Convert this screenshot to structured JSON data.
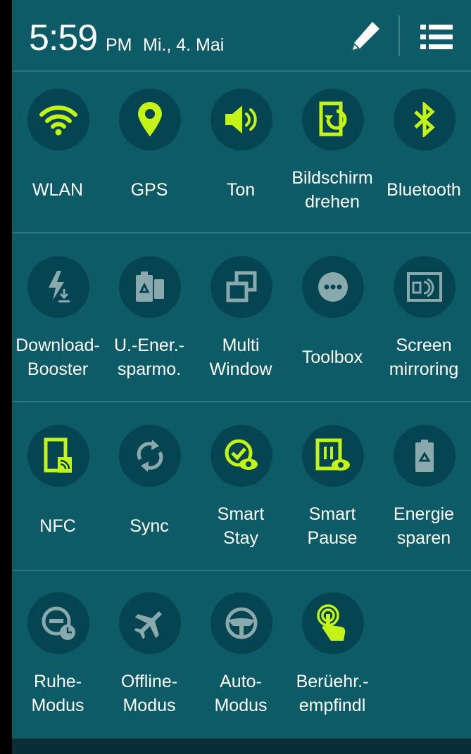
{
  "status": {
    "time": "5:59",
    "ampm": "PM",
    "date": "Mi., 4. Mai"
  },
  "colors": {
    "active": "#c4f318",
    "inactive": "#8aa9ad",
    "panel": "#0d5b66",
    "circle": "#054552"
  },
  "rows": [
    [
      {
        "label": "WLAN",
        "icon": "wifi-icon",
        "active": true
      },
      {
        "label": "GPS",
        "icon": "location-pin-icon",
        "active": true
      },
      {
        "label": "Ton",
        "icon": "speaker-icon",
        "active": true
      },
      {
        "label": "Bildschirm\ndrehen",
        "icon": "screen-rotation-icon",
        "active": true
      },
      {
        "label": "Bluetooth",
        "icon": "bluetooth-icon",
        "active": true
      }
    ],
    [
      {
        "label": "Download-\nBooster",
        "icon": "download-booster-icon",
        "active": false
      },
      {
        "label": "U.-Ener.-\nsparmo.",
        "icon": "ultra-power-saving-icon",
        "active": false
      },
      {
        "label": "Multi\nWindow",
        "icon": "multi-window-icon",
        "active": false
      },
      {
        "label": "Toolbox",
        "icon": "toolbox-icon",
        "active": false
      },
      {
        "label": "Screen\nmirroring",
        "icon": "screen-mirroring-icon",
        "active": false
      }
    ],
    [
      {
        "label": "NFC",
        "icon": "nfc-icon",
        "active": true
      },
      {
        "label": "Sync",
        "icon": "sync-icon",
        "active": false
      },
      {
        "label": "Smart\nStay",
        "icon": "smart-stay-icon",
        "active": true
      },
      {
        "label": "Smart\nPause",
        "icon": "smart-pause-icon",
        "active": true
      },
      {
        "label": "Energie\nsparen",
        "icon": "power-saving-icon",
        "active": false
      }
    ],
    [
      {
        "label": "Ruhe-\nModus",
        "icon": "blocking-mode-icon",
        "active": false
      },
      {
        "label": "Offline-\nModus",
        "icon": "airplane-icon",
        "active": false
      },
      {
        "label": "Auto-\nModus",
        "icon": "steering-wheel-icon",
        "active": false
      },
      {
        "label": "Berüehr.-\nempfindl",
        "icon": "touch-sensitivity-icon",
        "active": true
      }
    ]
  ]
}
